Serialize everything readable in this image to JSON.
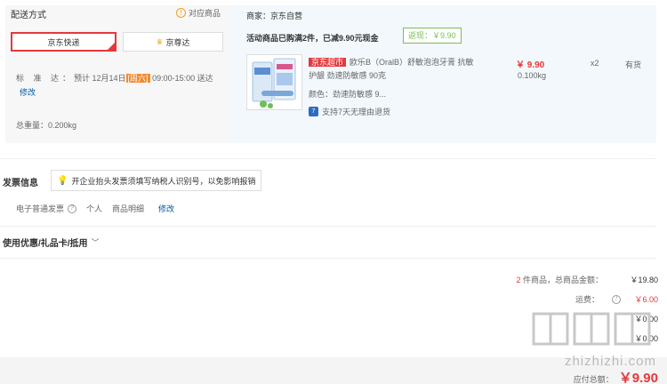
{
  "delivery": {
    "title": "配送方式",
    "corresponding_link": "对应商品",
    "options": [
      {
        "label": "京东快递",
        "selected": true
      },
      {
        "label": "京尊达",
        "selected": false
      }
    ],
    "eta_label": "标 准 达：",
    "eta_text": "预计 12月14日",
    "eta_weekday": "[周六]",
    "eta_time": "09:00-15:00 送达",
    "modify": "修改",
    "total_weight": "总重量：0.200kg"
  },
  "seller": {
    "name": "商家：京东自营",
    "promo": "活动商品已购满2件，已减9.90元现金",
    "rebate": "返现：￥9.90"
  },
  "product": {
    "tag": "京东超市",
    "name": "欧乐B（OralB）舒敏泡泡牙膏 抗敏护龈 劲速防敏感 90克",
    "color": "颜色：劲速防敏感 9...",
    "return_policy": "支持7天无理由退货",
    "price": "￥ 9.90",
    "weight": "0.100kg",
    "qty": "x2",
    "stock": "有货"
  },
  "invoice": {
    "title": "发票信息",
    "tip": "开企业抬头发票须填写纳税人识别号，以免影响报销",
    "type": "电子普通发票",
    "person": "个人",
    "detail": "商品明细",
    "modify": "修改"
  },
  "coupon": {
    "title": "使用优惠/礼品卡/抵用"
  },
  "summary": {
    "count": "2",
    "count_suffix": "件商品，总商品金额：",
    "total": "￥19.80",
    "shipping_label": "运费：",
    "shipping": "￥6.00",
    "row3_val": "￥0.00",
    "row4_val": "￥0.00",
    "payable_label": "应付总额：",
    "payable": "￥9.90"
  },
  "watermark": {
    "text": "zhizhizhi.com"
  },
  "colors": {
    "accent_red": "#e4393c",
    "link_blue": "#005aa0",
    "rebate_green": "#7abd54"
  }
}
